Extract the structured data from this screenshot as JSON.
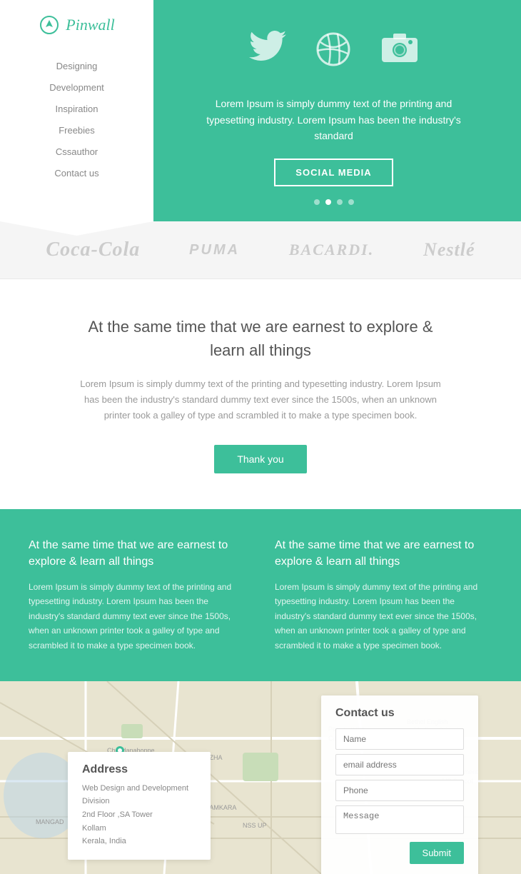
{
  "sidebar": {
    "logo_text": "Pinwall",
    "nav": [
      {
        "label": "Designing"
      },
      {
        "label": "Development"
      },
      {
        "label": "Inspiration"
      },
      {
        "label": "Freebies"
      },
      {
        "label": "Cssauthor"
      },
      {
        "label": "Contact us"
      }
    ]
  },
  "hero": {
    "description": "Lorem Ipsum is simply dummy text of the printing and typesetting industry. Lorem Ipsum has been the industry's standard",
    "social_media_btn": "SOCIAL MEDIA",
    "dots": [
      false,
      true,
      false,
      false
    ]
  },
  "brands": [
    {
      "name": "Coca-Cola",
      "class": "coca"
    },
    {
      "name": "PUMA",
      "class": "puma"
    },
    {
      "name": "BACARDI.",
      "class": "bacardi"
    },
    {
      "name": "Nestlé",
      "class": "nestle"
    }
  ],
  "mid_section": {
    "heading": "At the same time that we are earnest to explore & learn all things",
    "text": "Lorem Ipsum is simply dummy text of the printing and typesetting industry. Lorem Ipsum has been the industry's standard dummy text ever since the 1500s, when an unknown printer took a galley of type and scrambled it to make a type specimen book.",
    "thank_you_btn": "Thank you"
  },
  "info_section": {
    "col1": {
      "heading": "At the same time that we are earnest to explore & learn all things",
      "text": "Lorem Ipsum is simply dummy text of the printing and typesetting industry. Lorem Ipsum has been the industry's standard dummy text ever since the 1500s, when an unknown printer took a galley of type and scrambled it to make a type specimen book."
    },
    "col2": {
      "heading": "At the same time that we are earnest to explore & learn all things",
      "text": "Lorem Ipsum is simply dummy text of the printing and typesetting industry. Lorem Ipsum has been the industry's standard dummy text ever since the 1500s, when an unknown printer took a galley of type and scrambled it to make a type specimen book."
    }
  },
  "address": {
    "title": "Address",
    "line1": "Web Design and Development Division",
    "line2": "2nd Floor ,SA Tower",
    "line3": "Kollam",
    "line4": "Kerala, India"
  },
  "contact_form": {
    "title": "Contact us",
    "name_placeholder": "Name",
    "email_placeholder": "email address",
    "phone_placeholder": "Phone",
    "message_placeholder": "Message",
    "submit_btn": "Submit"
  }
}
